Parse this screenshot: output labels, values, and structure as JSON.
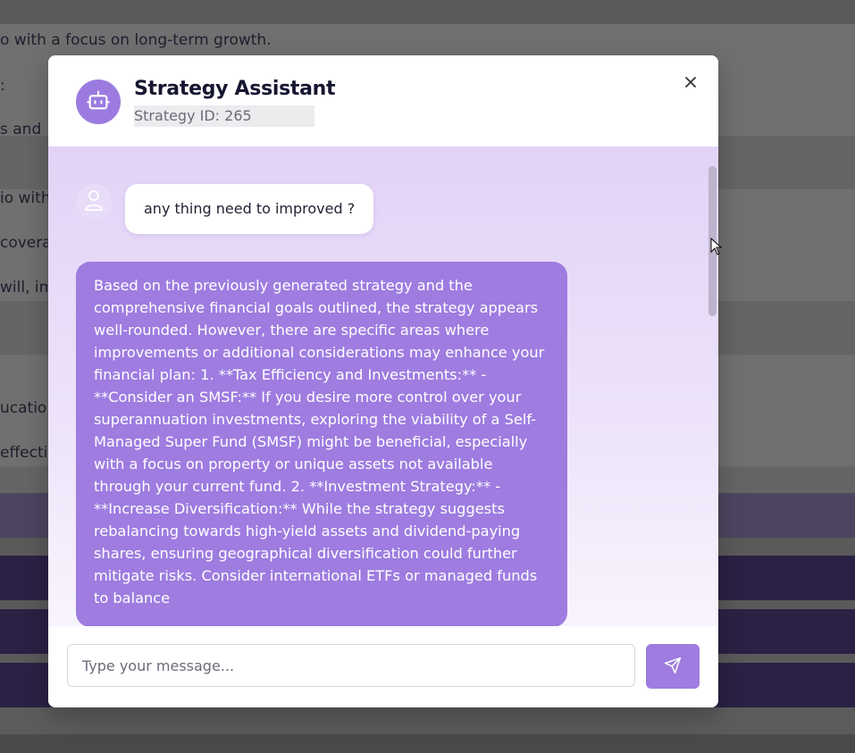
{
  "background_page": {
    "lines": [
      "o with a focus on long-term growth.",
      ":",
      "s and",
      "io with",
      "covera",
      "will, imp",
      "ucatio",
      "effectiv"
    ]
  },
  "modal": {
    "title": "Strategy Assistant",
    "strategy_id": "Strategy ID: 265",
    "close_icon": "close-icon",
    "bot_icon": "robot-icon"
  },
  "chat": {
    "messages": [
      {
        "role": "user",
        "text": "any thing need to improved ?"
      },
      {
        "role": "assistant",
        "text": "Based on the previously generated strategy and the comprehensive financial goals outlined, the strategy appears well-rounded. However, there are specific areas where improvements or additional considerations may enhance your financial plan: 1. **Tax Efficiency and Investments:** - **Consider an SMSF:** If you desire more control over your superannuation investments, exploring the viability of a Self-Managed Super Fund (SMSF) might be beneficial, especially with a focus on property or unique assets not available through your current fund. 2. **Investment Strategy:** - **Increase Diversification:** While the strategy suggests rebalancing towards high-yield assets and dividend-paying shares, ensuring geographical diversification could further mitigate risks. Consider international ETFs or managed funds to balance"
      }
    ]
  },
  "composer": {
    "placeholder": "Type your message...",
    "send_icon": "send-icon"
  },
  "colors": {
    "accent": "#9e7ce0",
    "dark_text": "#161630"
  }
}
